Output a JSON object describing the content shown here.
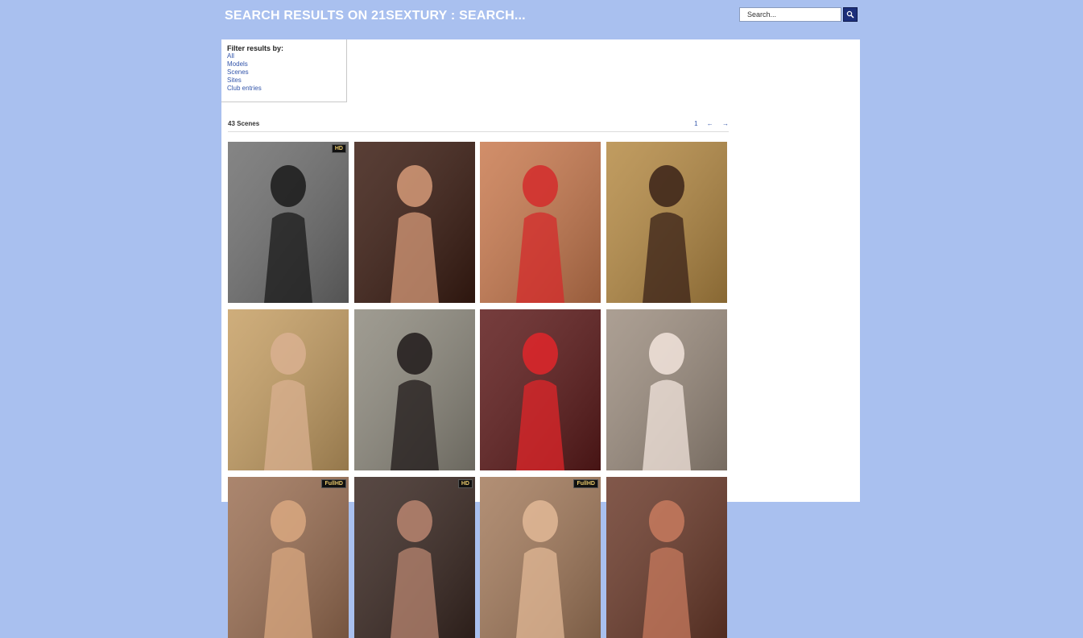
{
  "header": {
    "title": "SEARCH RESULTS ON 21SEXTURY : SEARCH...",
    "search_placeholder": "Search...",
    "search_value": "Search..."
  },
  "filter": {
    "title": "Filter results by:",
    "links": [
      "All",
      "Models",
      "Scenes",
      "Sites",
      "Club entries"
    ]
  },
  "results": {
    "count_label": "43 Scenes",
    "pager": {
      "current_page": "1",
      "prev": "←",
      "next": "→"
    }
  },
  "thumbnails": [
    {
      "badge": "HD",
      "bg": "#6f6f6f",
      "fg": "#1a1a1a"
    },
    {
      "badge": "",
      "bg": "#3b1c12",
      "fg": "#d59a78"
    },
    {
      "badge": "",
      "bg": "#c97a4f",
      "fg": "#d42b2b"
    },
    {
      "badge": "",
      "bg": "#b58a44",
      "fg": "#3a2218"
    },
    {
      "badge": "",
      "bg": "#c69f64",
      "fg": "#d9b090"
    },
    {
      "badge": "",
      "bg": "#8e8a7e",
      "fg": "#201a1a"
    },
    {
      "badge": "",
      "bg": "#5d1a1a",
      "fg": "#e0262a"
    },
    {
      "badge": "",
      "bg": "#9d8e80",
      "fg": "#f2e4dc"
    },
    {
      "badge": "FullHD",
      "bg": "#9c7054",
      "fg": "#d9a880"
    },
    {
      "badge": "HD",
      "bg": "#3a2822",
      "fg": "#b88570"
    },
    {
      "badge": "FullHD",
      "bg": "#a47b5c",
      "fg": "#e2b896"
    },
    {
      "badge": "",
      "bg": "#6b3a2a",
      "fg": "#c77a5e"
    }
  ]
}
